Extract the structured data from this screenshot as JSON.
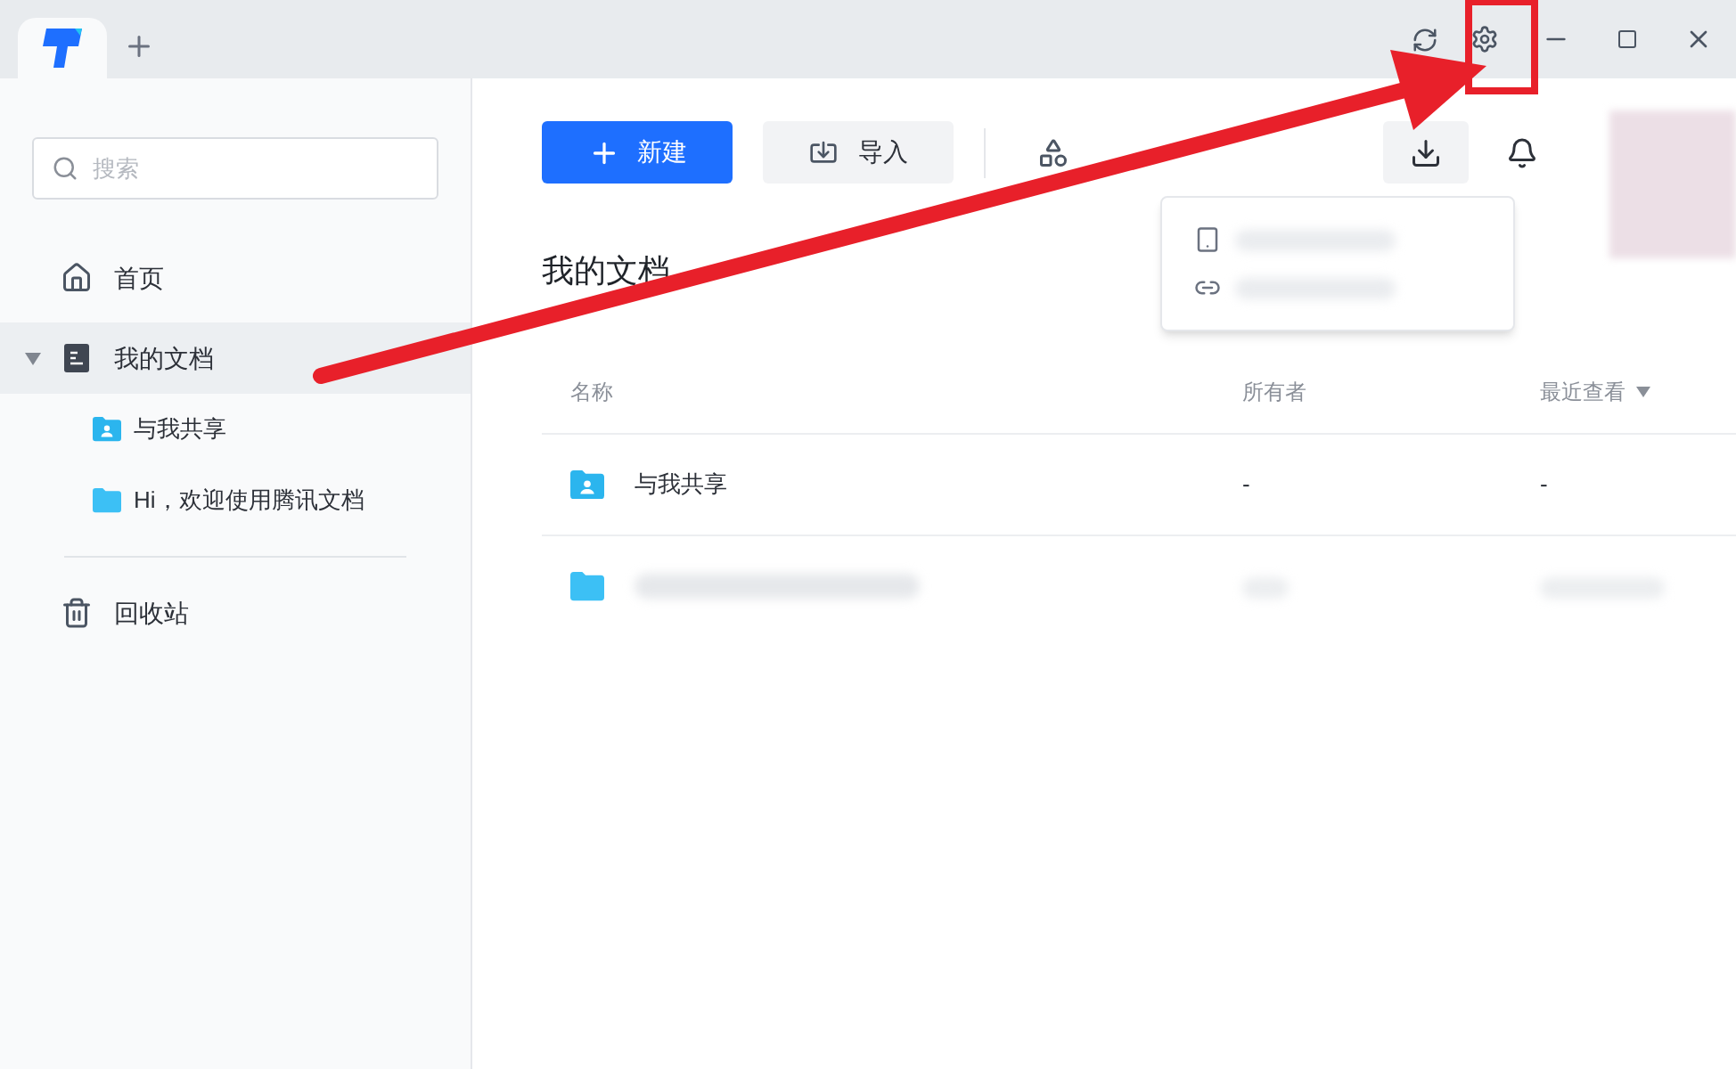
{
  "sidebar": {
    "search": {
      "placeholder": "搜索"
    },
    "items": [
      {
        "kind": "home",
        "label": "首页",
        "selected": false
      },
      {
        "kind": "docs",
        "label": "我的文档",
        "selected": true,
        "expanded": true,
        "children": [
          {
            "kind": "shared-folder",
            "label": "与我共享",
            "selected": false
          },
          {
            "kind": "folder",
            "label": "Hi，欢迎使用腾讯文档",
            "selected": false
          }
        ]
      }
    ],
    "trash": {
      "label": "回收站"
    }
  },
  "toolbar": {
    "new_button": "新建",
    "import_button": "导入"
  },
  "content": {
    "title": "我的文档",
    "table": {
      "columns": [
        {
          "label": "名称"
        },
        {
          "label": "所有者"
        },
        {
          "label": "最近查看",
          "sorted": true
        }
      ],
      "rows": [
        {
          "kind": "shared-folder",
          "name": "与我共享",
          "owner": "-",
          "viewed": "-"
        },
        {
          "kind": "blurred-folder"
        }
      ]
    }
  }
}
